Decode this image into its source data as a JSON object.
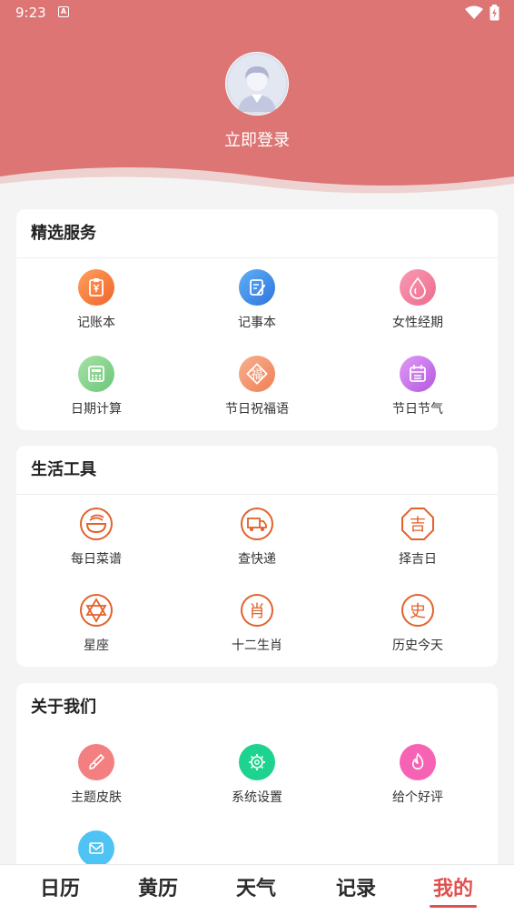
{
  "status_bar": {
    "time": "9:23",
    "notification": "A"
  },
  "profile": {
    "login_label": "立即登录"
  },
  "sections": {
    "featured": {
      "title": "精选服务",
      "items": [
        {
          "label": "记账本",
          "icon": "ledger-icon",
          "color": "#f77d3f"
        },
        {
          "label": "记事本",
          "icon": "notepad-icon",
          "color": "#3e8eea"
        },
        {
          "label": "女性经期",
          "icon": "drop-icon",
          "color": "#f27d9c"
        },
        {
          "label": "日期计算",
          "icon": "calculator-icon",
          "color": "#84d08a"
        },
        {
          "label": "节日祝福语",
          "icon": "blessing-icon",
          "color": "#f3936b"
        },
        {
          "label": "节日节气",
          "icon": "calendar-icon",
          "color": "#c36ee6"
        }
      ]
    },
    "tools": {
      "title": "生活工具",
      "items": [
        {
          "label": "每日菜谱",
          "icon": "bowl-icon",
          "color": "#e2622c"
        },
        {
          "label": "查快递",
          "icon": "truck-icon",
          "color": "#e2622c"
        },
        {
          "label": "择吉日",
          "icon": "lucky-icon",
          "glyph": "吉",
          "color": "#e2622c"
        },
        {
          "label": "星座",
          "icon": "star-of-david-icon",
          "color": "#e2622c"
        },
        {
          "label": "十二生肖",
          "icon": "zodiac-icon",
          "glyph": "肖",
          "color": "#e2622c"
        },
        {
          "label": "历史今天",
          "icon": "history-icon",
          "glyph": "史",
          "color": "#e2622c"
        }
      ]
    },
    "about": {
      "title": "关于我们",
      "items": [
        {
          "label": "主题皮肤",
          "icon": "brush-icon",
          "color": "#f47f80"
        },
        {
          "label": "系统设置",
          "icon": "gear-icon",
          "color": "#1ed38f"
        },
        {
          "label": "给个好评",
          "icon": "flame-icon",
          "color": "#f763b4"
        },
        {
          "label": "",
          "icon": "mail-icon",
          "color": "#4fc3f3"
        }
      ]
    }
  },
  "bottom_nav": {
    "tabs": [
      "日历",
      "黄历",
      "天气",
      "记录",
      "我的"
    ],
    "active_index": 4,
    "active_color": "#e0504f"
  },
  "colors": {
    "header": "#dc7574",
    "background": "#f4f4f4"
  }
}
